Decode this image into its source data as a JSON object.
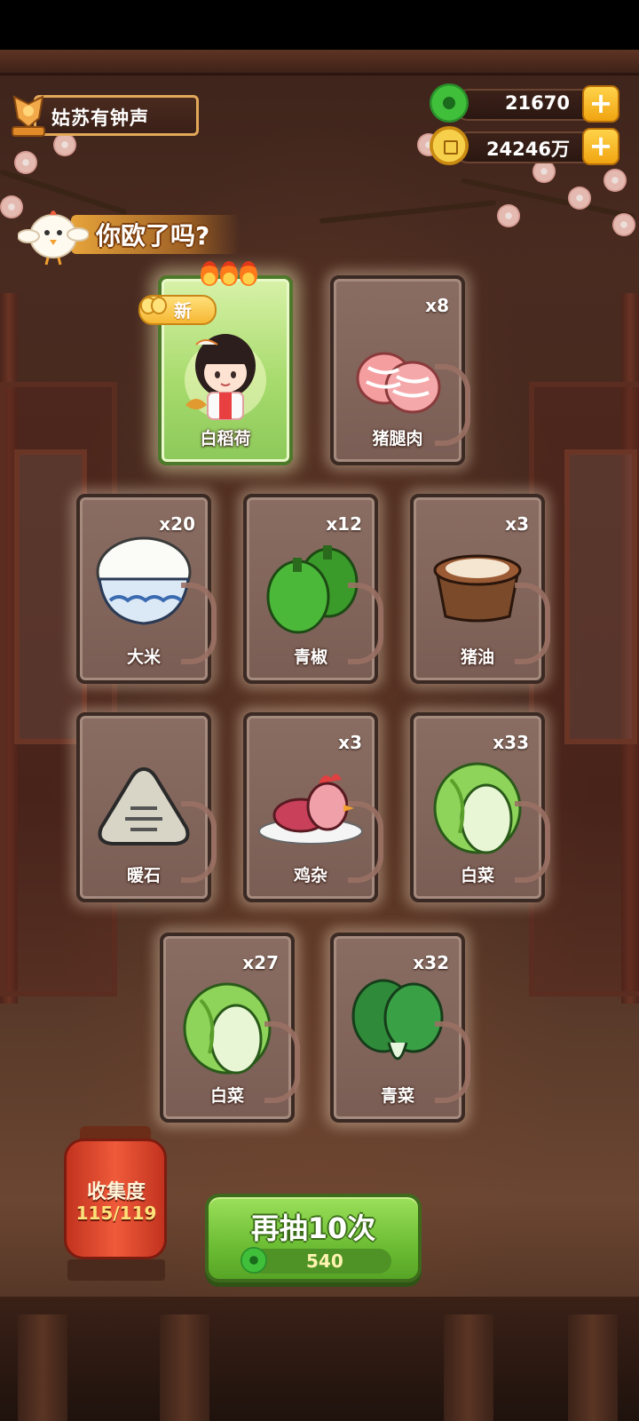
{
  "player": {
    "name": "姑苏有钟声"
  },
  "currencies": {
    "jade": {
      "value": "21670",
      "icon": "jade-icon"
    },
    "coins": {
      "value": "24246万",
      "icon": "copper-coin-icon"
    }
  },
  "banner": {
    "text": "你欧了吗?"
  },
  "new_badge": "新",
  "cards": [
    {
      "name": "白稻荷",
      "count": "",
      "icon": "character-portrait",
      "is_new": true,
      "stars": 3
    },
    {
      "name": "猪腿肉",
      "count": "x8",
      "icon": "pork-leg-icon"
    },
    {
      "name": "大米",
      "count": "x20",
      "icon": "rice-bowl-icon"
    },
    {
      "name": "青椒",
      "count": "x12",
      "icon": "green-pepper-icon"
    },
    {
      "name": "猪油",
      "count": "x3",
      "icon": "lard-icon"
    },
    {
      "name": "暖石",
      "count": "",
      "icon": "warm-stone-icon"
    },
    {
      "name": "鸡杂",
      "count": "x3",
      "icon": "chicken-giblets-icon"
    },
    {
      "name": "白菜",
      "count": "x33",
      "icon": "cabbage-icon"
    },
    {
      "name": "白菜",
      "count": "x27",
      "icon": "cabbage-icon"
    },
    {
      "name": "青菜",
      "count": "x32",
      "icon": "bok-choy-icon"
    }
  ],
  "collection": {
    "label": "收集度",
    "progress": "115/119"
  },
  "draw_button": {
    "label": "再抽10次",
    "cost": "540"
  },
  "colors": {
    "green_button": "#6cbd34",
    "gold": "#f6b733",
    "lantern_red": "#ef5a3a"
  }
}
